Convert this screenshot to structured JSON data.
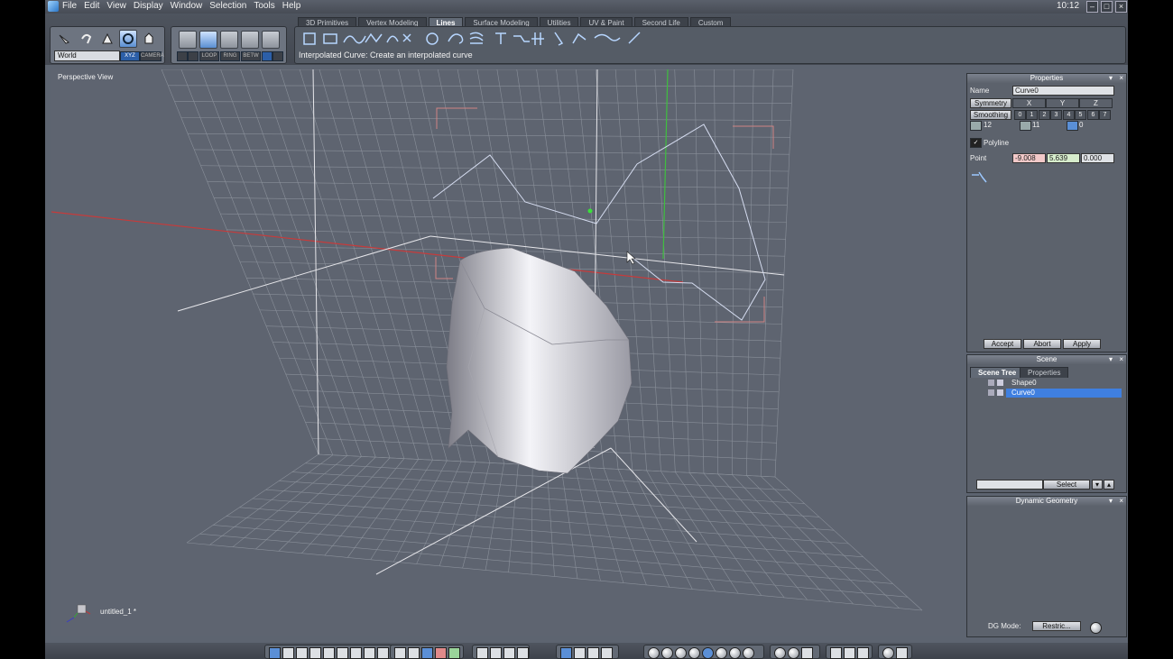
{
  "menubar": {
    "items": [
      "File",
      "Edit",
      "View",
      "Display",
      "Window",
      "Selection",
      "Tools",
      "Help"
    ],
    "clock": "10:12"
  },
  "toolbar": {
    "tabs": [
      {
        "label": "3D Primitives",
        "active": false
      },
      {
        "label": "Vertex Modeling",
        "active": false
      },
      {
        "label": "Lines",
        "active": true
      },
      {
        "label": "Surface Modeling",
        "active": false
      },
      {
        "label": "Utilities",
        "active": false
      },
      {
        "label": "UV & Paint",
        "active": false
      },
      {
        "label": "Second Life",
        "active": false
      },
      {
        "label": "Custom",
        "active": false
      }
    ],
    "coord_system": "World",
    "xyz_label": "XYZ",
    "camera_label": "CAMERA",
    "loop_label": "LOOP",
    "ring_label": "RING",
    "betw_label": "BETW",
    "status": "Interpolated Curve: Create an interpolated curve"
  },
  "viewport": {
    "label": "Perspective View",
    "document": "untitled_1 *"
  },
  "properties": {
    "title": "Properties",
    "name_label": "Name",
    "name_value": "Curve0",
    "symmetry_label": "Symmetry",
    "axes": [
      "X",
      "Y",
      "Z"
    ],
    "smoothing_label": "Smoothing",
    "smoothing_levels": [
      "0",
      "1",
      "2",
      "3",
      "4",
      "5",
      "6",
      "7"
    ],
    "counts": [
      "12",
      "11",
      "0"
    ],
    "polyline_label": "Polyline",
    "point_label": "Point",
    "point_values": [
      "-9.008",
      "5.639",
      "0.000"
    ],
    "accept": "Accept",
    "abort": "Abort",
    "apply": "Apply"
  },
  "scene": {
    "title": "Scene",
    "tabs": [
      "Scene Tree",
      "Properties"
    ],
    "items": [
      {
        "label": "Shape0",
        "selected": false
      },
      {
        "label": "Curve0",
        "selected": true
      }
    ],
    "select_button": "Select"
  },
  "dynamic": {
    "title": "Dynamic Geometry",
    "mode_label": "DG Mode:",
    "mode_value": "Restric..."
  },
  "colors": {
    "selection": "#3f7fe0",
    "grid": "#8a909a",
    "x_axis": "#c63b3b",
    "y_axis": "#3fbf3f"
  }
}
